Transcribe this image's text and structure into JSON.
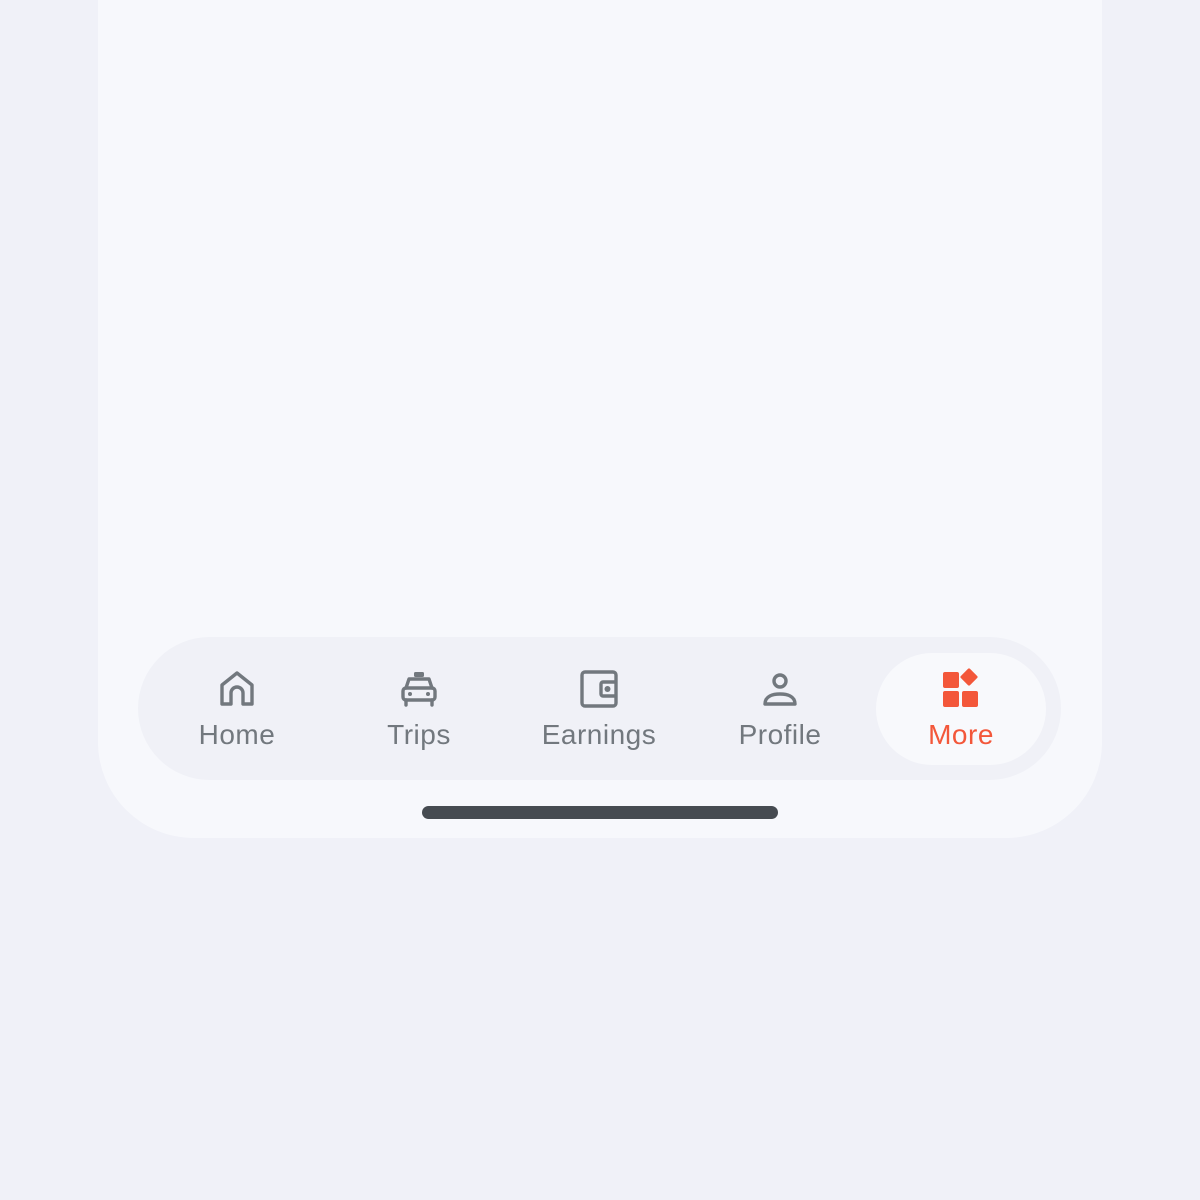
{
  "nav": {
    "items": [
      {
        "label": "Home",
        "icon": "home-icon",
        "active": false
      },
      {
        "label": "Trips",
        "icon": "taxi-icon",
        "active": false
      },
      {
        "label": "Earnings",
        "icon": "wallet-icon",
        "active": false
      },
      {
        "label": "Profile",
        "icon": "person-icon",
        "active": false
      },
      {
        "label": "More",
        "icon": "apps-icon",
        "active": true
      }
    ]
  },
  "colors": {
    "background": "#f0f1f8",
    "screen": "#f7f8fc",
    "tabbar": "#f0f1f7",
    "inactive": "#72787e",
    "accent": "#f3573a",
    "home_indicator": "#464b51"
  }
}
